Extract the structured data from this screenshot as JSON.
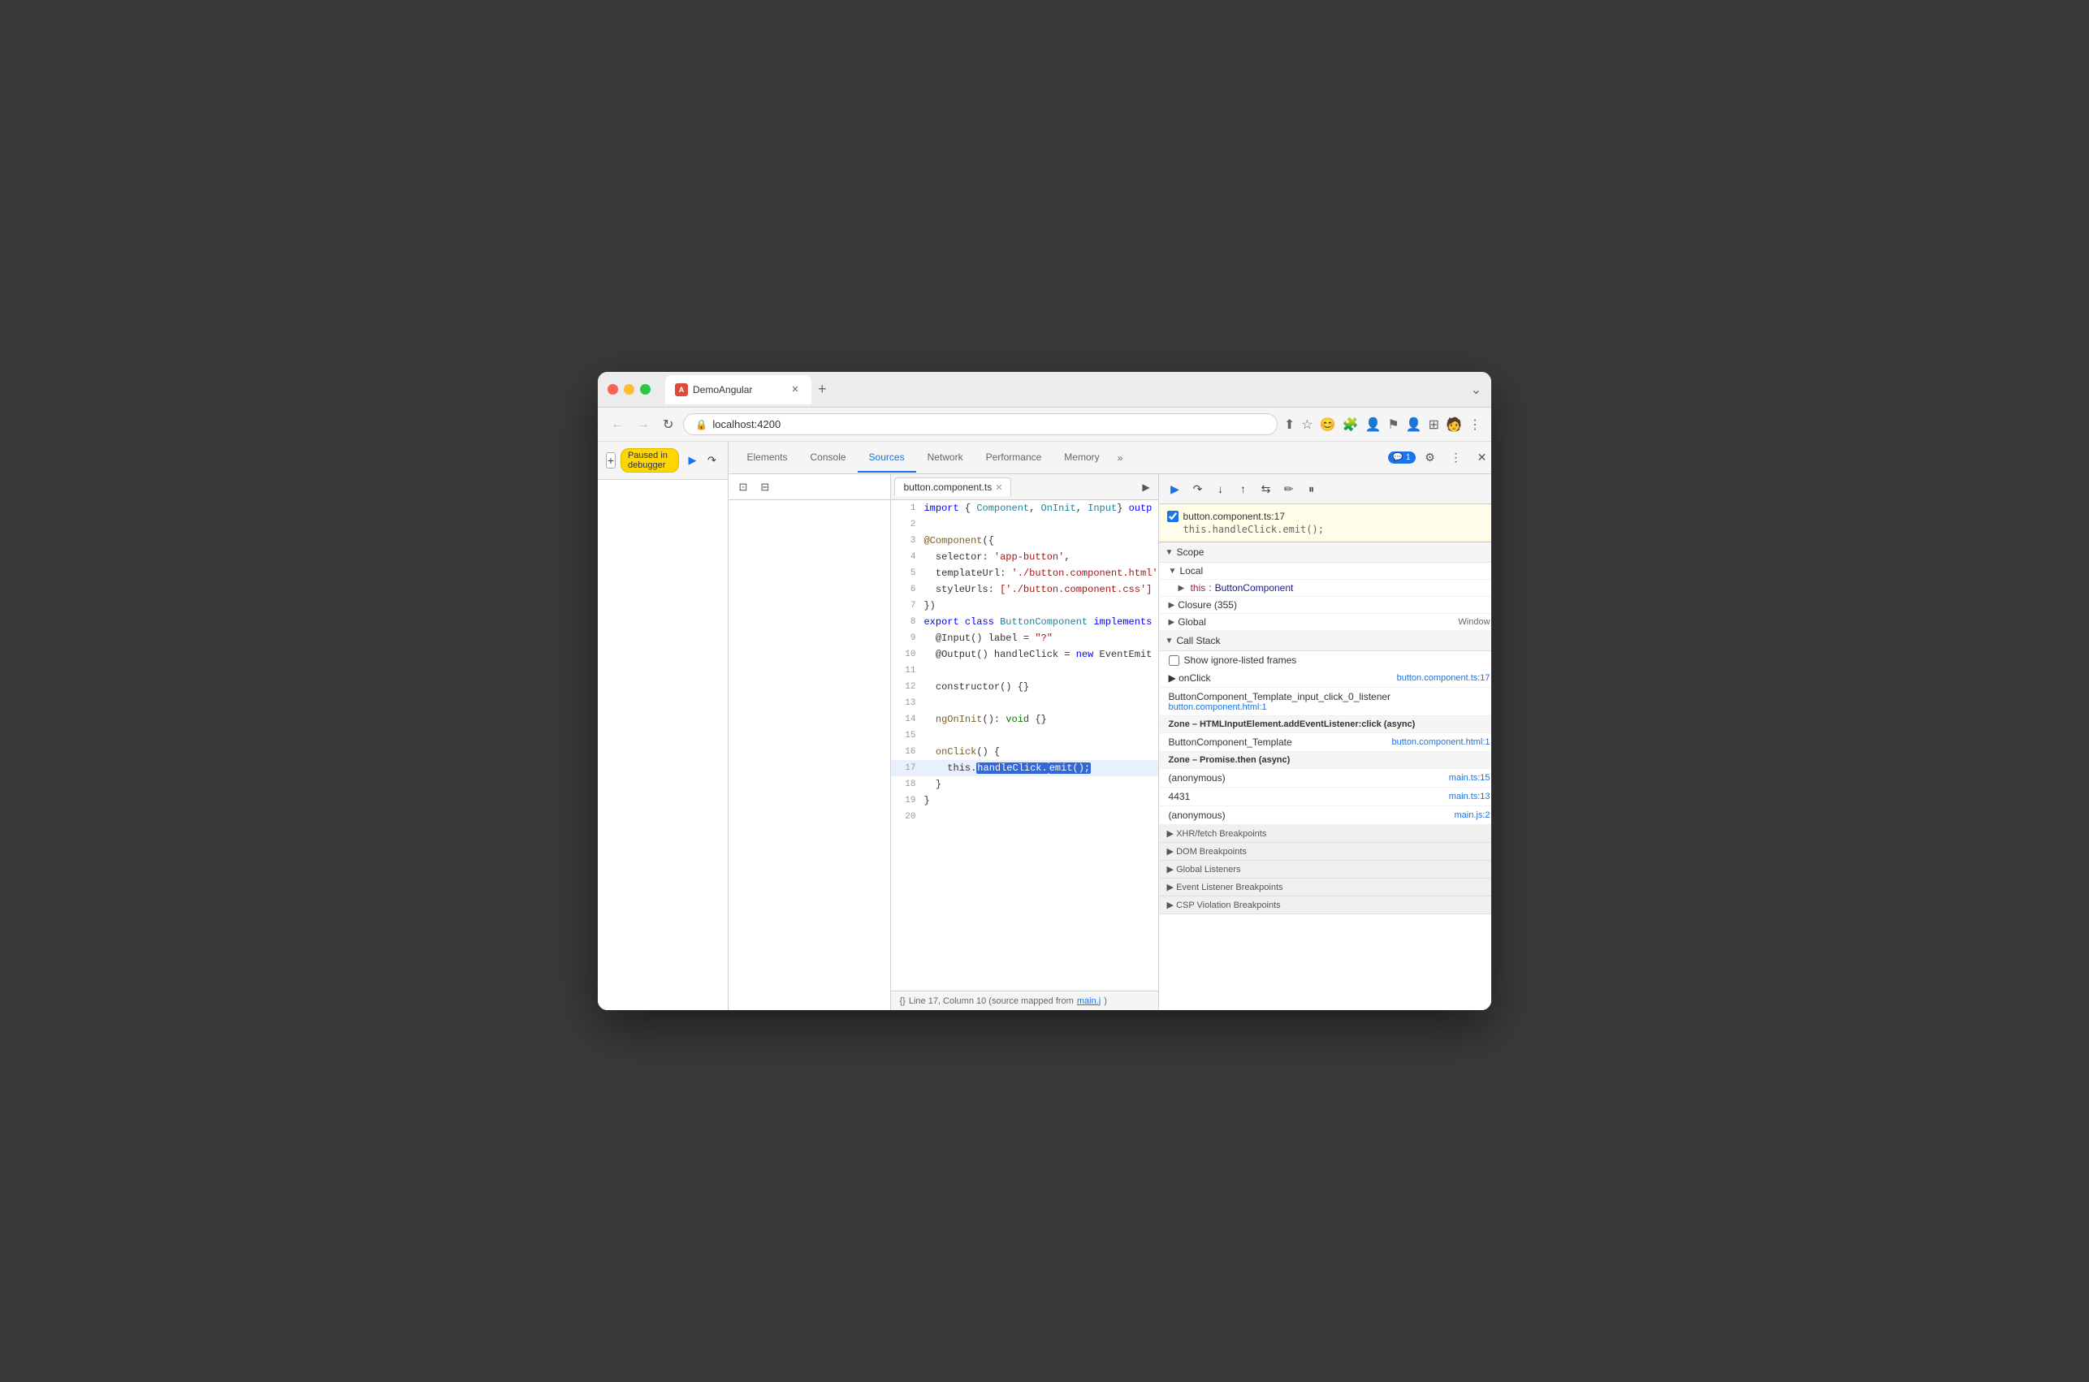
{
  "browser": {
    "tab_title": "DemoAngular",
    "tab_favicon": "A",
    "address": "localhost:4200",
    "window_controls_label": "⌄"
  },
  "devtools": {
    "tabs": [
      "Elements",
      "Console",
      "Sources",
      "Network",
      "Performance",
      "Memory"
    ],
    "active_tab": "Sources",
    "more_tabs_label": "»",
    "notification": "1",
    "settings_icon": "⚙",
    "more_options_icon": "⋮",
    "close_icon": "✕"
  },
  "debugger_bar": {
    "add_label": "+",
    "paused_label": "Paused in debugger",
    "resume_icon": "▶",
    "step_over_icon": "↷",
    "step_into_icon": "↓",
    "step_out_icon": "↑",
    "step_back_icon": "⇆",
    "deactivate_icon": "⏸"
  },
  "editor": {
    "filename": "button.component.ts",
    "close_icon": "✕",
    "lines": [
      {
        "num": "2",
        "tokens": [
          {
            "t": "  ",
            "c": ""
          }
        ]
      },
      {
        "num": "3",
        "tokens": [
          {
            "t": "@Component({",
            "c": "dec"
          }
        ]
      },
      {
        "num": "4",
        "tokens": [
          {
            "t": "  selector: ",
            "c": ""
          },
          {
            "t": "'app-button'",
            "c": "str"
          },
          {
            "t": ",",
            "c": ""
          }
        ]
      },
      {
        "num": "5",
        "tokens": [
          {
            "t": "  templateUrl: ",
            "c": ""
          },
          {
            "t": "'./button.component.html'",
            "c": "str"
          },
          {
            "t": ",",
            "c": ""
          }
        ]
      },
      {
        "num": "6",
        "tokens": [
          {
            "t": "  styleUrls: ",
            "c": ""
          },
          {
            "t": "['./button.component.css']",
            "c": "str"
          }
        ]
      },
      {
        "num": "7",
        "tokens": [
          {
            "t": "})",
            "c": ""
          }
        ]
      },
      {
        "num": "8",
        "tokens": [
          {
            "t": "export class ",
            "c": "kw"
          },
          {
            "t": "ButtonComponent",
            "c": "cls"
          },
          {
            "t": " implements",
            "c": "kw"
          }
        ]
      },
      {
        "num": "9",
        "tokens": [
          {
            "t": "  @Input() label = ",
            "c": ""
          },
          {
            "t": "\"?\"",
            "c": "str"
          },
          {
            "t": ";",
            "c": ""
          }
        ]
      },
      {
        "num": "10",
        "tokens": [
          {
            "t": "  @Output() handleClick = new EventEmit",
            "c": ""
          }
        ]
      },
      {
        "num": "11",
        "tokens": [
          {
            "t": "",
            "c": ""
          }
        ]
      },
      {
        "num": "12",
        "tokens": [
          {
            "t": "  constructor() {}",
            "c": ""
          }
        ]
      },
      {
        "num": "13",
        "tokens": [
          {
            "t": "",
            "c": ""
          }
        ]
      },
      {
        "num": "14",
        "tokens": [
          {
            "t": "  ngOnInit(): void {}",
            "c": ""
          }
        ]
      },
      {
        "num": "15",
        "tokens": [
          {
            "t": "",
            "c": ""
          }
        ]
      },
      {
        "num": "16",
        "tokens": [
          {
            "t": "  onClick() {",
            "c": ""
          }
        ]
      },
      {
        "num": "17",
        "tokens": [
          {
            "t": "    this.",
            "c": ""
          },
          {
            "t": "handleClick.",
            "c": "highlighted"
          },
          {
            "t": "emit();",
            "c": "highlighted2"
          }
        ],
        "active": true
      },
      {
        "num": "18",
        "tokens": [
          {
            "t": "  }",
            "c": ""
          }
        ]
      },
      {
        "num": "19",
        "tokens": [
          {
            "t": "}",
            "c": ""
          }
        ]
      },
      {
        "num": "20",
        "tokens": [
          {
            "t": "",
            "c": ""
          }
        ]
      }
    ],
    "status_bar": "{} Line 17, Column 10 (source mapped from main.j",
    "status_link": "main.j"
  },
  "breakpoint_info": {
    "checked": true,
    "file": "button.component.ts:17",
    "code": "this.handleClick.emit();"
  },
  "scope": {
    "header": "Scope",
    "local_header": "Local",
    "this_key": "this",
    "this_val": "ButtonComponent",
    "closure_header": "Closure (355)",
    "global_header": "Global",
    "global_val": "Window"
  },
  "call_stack": {
    "header": "Call Stack",
    "ignore_label": "Show ignore-listed frames",
    "items": [
      {
        "name": "onClick",
        "file": "button.component.ts:17",
        "arrow": true
      },
      {
        "name": "ButtonComponent_Template_input_click_0_listener",
        "file": "button.component.html:1",
        "arrow": false
      },
      {
        "zone_header": "Zone – HTMLInputElement.addEventListener:click (async)"
      },
      {
        "name": "ButtonComponent_Template",
        "file": "button.component.html:1",
        "arrow": false
      },
      {
        "zone_header": "Zone – Promise.then (async)"
      },
      {
        "name": "(anonymous)",
        "file": "main.ts:15",
        "arrow": false
      },
      {
        "name": "4431",
        "file": "main.ts:13",
        "arrow": false
      },
      {
        "name": "(anonymous)",
        "file": "main.js:2",
        "arrow": false
      }
    ]
  },
  "breakpoints": {
    "xhr_label": "▶ XHR/fetch Breakpoints",
    "dom_label": "▶ DOM Breakpoints",
    "global_label": "▶ Global Listeners",
    "event_label": "▶ Event Listener Breakpoints",
    "csp_label": "▶ CSP Violation Breakpoints"
  }
}
